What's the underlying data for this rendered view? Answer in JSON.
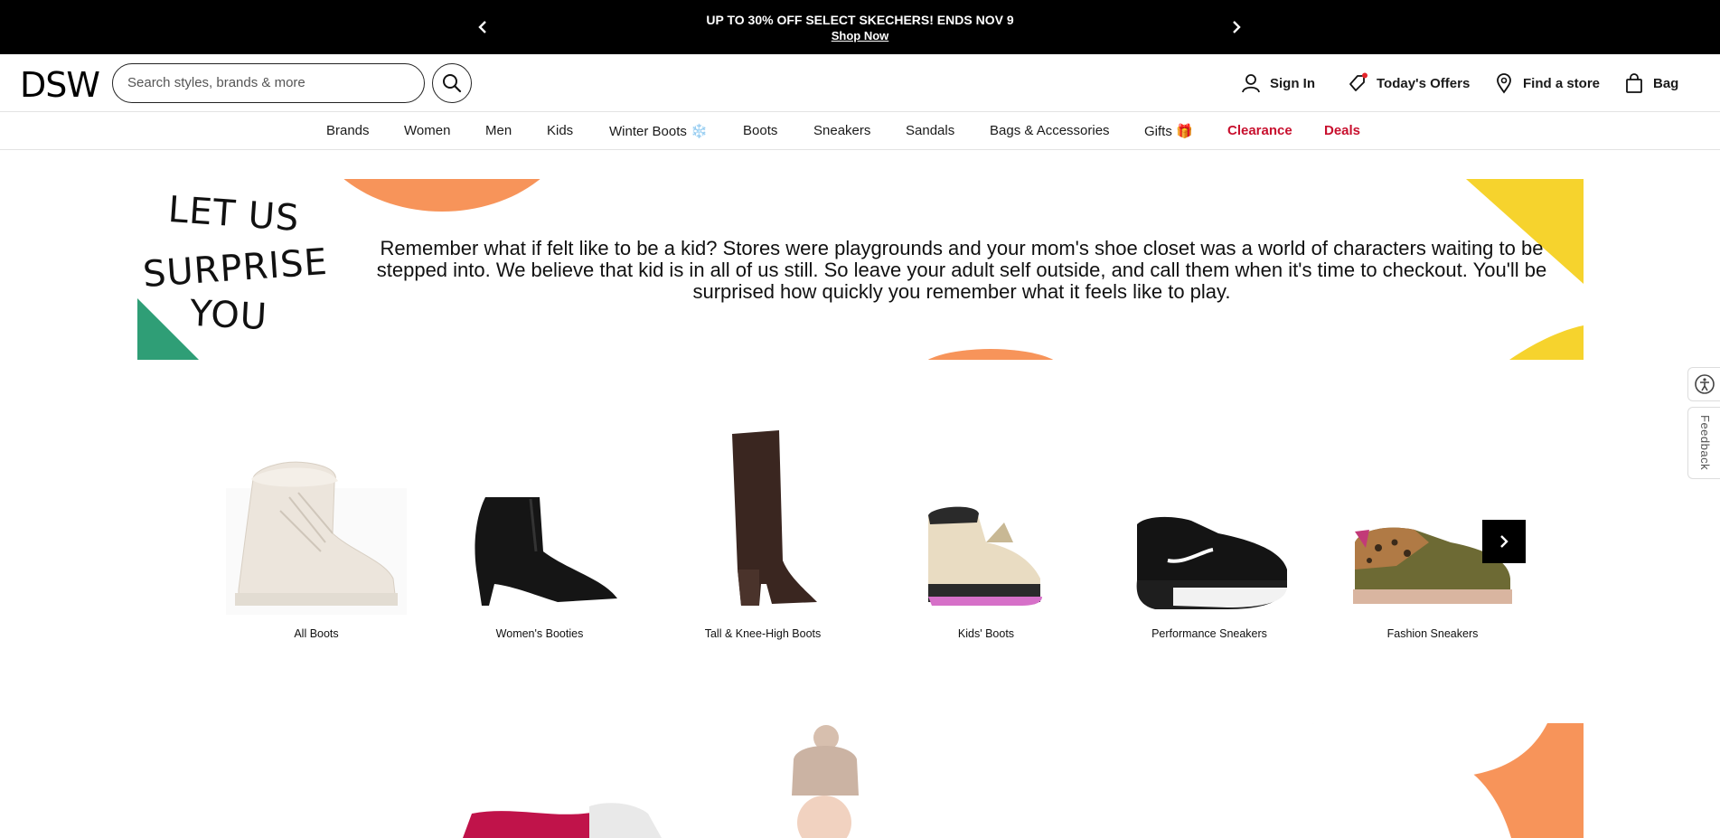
{
  "promo": {
    "text": "UP TO 30% OFF SELECT SKECHERS! ENDS NOV 9",
    "link": "Shop Now",
    "prev_icon": "chevron-left-icon",
    "next_icon": "chevron-right-icon"
  },
  "header": {
    "logo": "DSW",
    "search_placeholder": "Search styles, brands & more",
    "search_icon": "search-icon",
    "sign_in": "Sign In",
    "offers": "Today's Offers",
    "store": "Find a store",
    "bag": "Bag"
  },
  "nav": {
    "items": [
      "Brands",
      "Women",
      "Men",
      "Kids",
      "Winter Boots ❄️",
      "Boots",
      "Sneakers",
      "Sandals",
      "Bags & Accessories",
      "Gifts 🎁",
      "Clearance",
      "Deals"
    ]
  },
  "surprise": {
    "title_line1": "LET US",
    "title_line2": "SURPRISE",
    "title_line3": "YOU",
    "message": "Remember what if felt like to be a kid? Stores were playgrounds and your mom's shoe closet was a world of characters waiting to be stepped into. We believe that kid is in all of us still. So leave your adult self outside, and call them when it's time to checkout. You'll be surprised how quickly you remember what it feels like to play."
  },
  "categories": [
    {
      "label": "All Boots"
    },
    {
      "label": "Women's Booties"
    },
    {
      "label": "Tall & Knee-High Boots"
    },
    {
      "label": "Kids' Boots"
    },
    {
      "label": "Performance Sneakers"
    },
    {
      "label": "Fashion Sneakers"
    }
  ],
  "side": {
    "feedback": "Feedback",
    "accessibility_icon": "accessibility-icon"
  },
  "colors": {
    "orange": "#f7945a",
    "yellow": "#f6d32d",
    "green": "#2f9e76",
    "clearance_red": "#c8102e"
  }
}
